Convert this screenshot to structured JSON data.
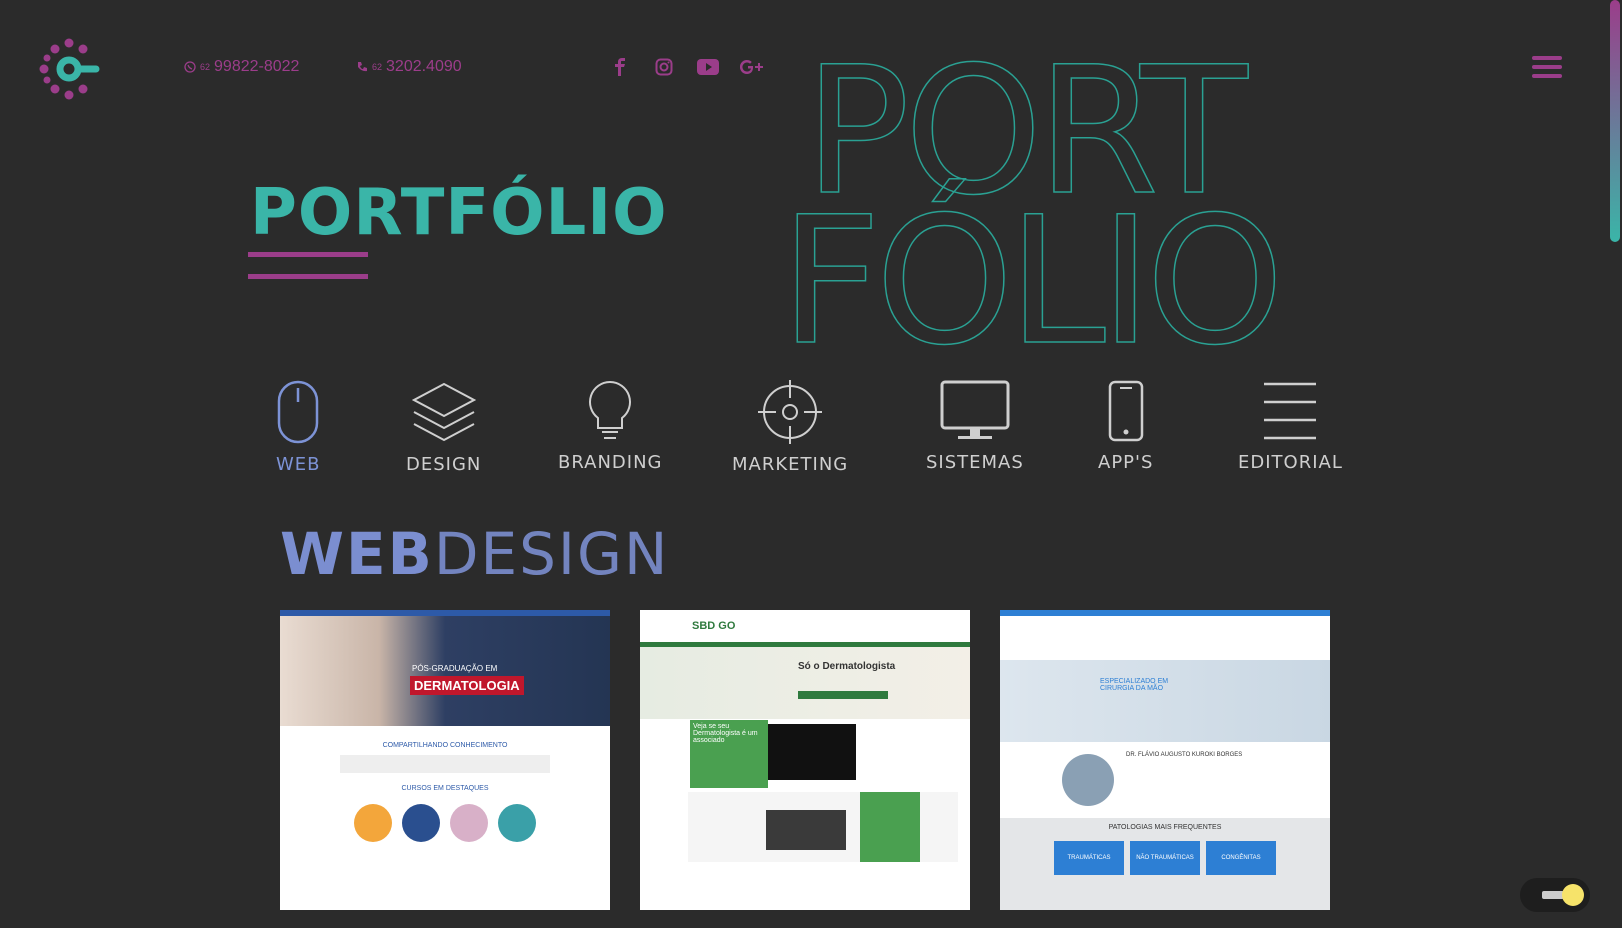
{
  "header": {
    "whatsapp_prefix": "62",
    "whatsapp_number": "99822-8022",
    "phone_prefix": "62",
    "phone_number": "3202.4090",
    "social": [
      "facebook-icon",
      "instagram-icon",
      "youtube-icon",
      "google-plus-icon"
    ]
  },
  "hero": {
    "title": "PORTFÓLIO",
    "outline_line1": "PORT",
    "outline_line2": "FÓLIO"
  },
  "categories": [
    {
      "label": "WEB",
      "icon": "mouse-icon",
      "active": true
    },
    {
      "label": "DESIGN",
      "icon": "layers-icon",
      "active": false
    },
    {
      "label": "BRANDING",
      "icon": "lightbulb-icon",
      "active": false
    },
    {
      "label": "MARKETING",
      "icon": "target-icon",
      "active": false
    },
    {
      "label": "SISTEMAS",
      "icon": "monitor-icon",
      "active": false
    },
    {
      "label": "APP'S",
      "icon": "phone-icon",
      "active": false
    },
    {
      "label": "EDITORIAL",
      "icon": "lines-icon",
      "active": false
    }
  ],
  "section": {
    "title_bold": "WEB",
    "title_light": "DESIGN"
  },
  "thumbnails": [
    {
      "headline": "PÓS-GRADUAÇÃO EM",
      "banner": "DERMATOLOGIA",
      "sub": "COMPARTILHANDO CONHECIMENTO",
      "row": "CURSOS EM DESTAQUES"
    },
    {
      "logo": "SBD GO",
      "headline": "Só o Dermatologista",
      "box": "Veja se seu Dermatologista é um associado"
    },
    {
      "banner": "ESPECIALIZADO EM CIRURGIA DA MÃO",
      "doctor": "DR. FLÁVIO AUGUSTO KUROKI BORGES",
      "row": "PATOLOGIAS MAIS FREQUENTES",
      "tags": [
        "TRAUMÁTICAS",
        "NÃO TRAUMÁTICAS",
        "CONGÊNITAS"
      ]
    }
  ],
  "colors": {
    "accent": "#3ab5a8",
    "brand": "#9b3d8a",
    "active": "#7d93d6",
    "background": "#2b2b2b"
  }
}
